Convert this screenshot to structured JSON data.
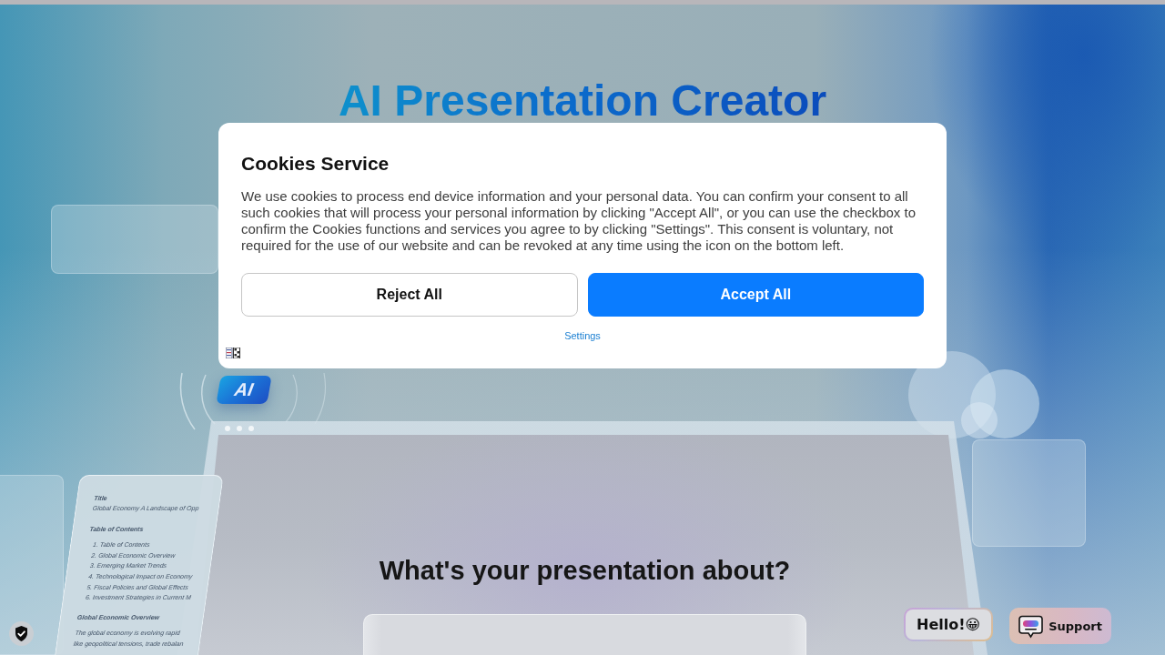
{
  "header": {
    "title": "AI Presentation Creator"
  },
  "hero": {
    "badge": "AI",
    "document": {
      "label": "Title",
      "title": "Global Economy A Landscape of Opp",
      "toc_heading": "Table of Contents",
      "toc": [
        "1. Table of Contents",
        "2. Global Economic Overview",
        "3. Emerging Market Trends",
        "4. Technological Impact on Economy",
        "5. Fiscal Policies and Global Effects",
        "6. Investment Strategies in Current M"
      ],
      "section_heading": "Global Economic Overview",
      "section_lines": [
        "The global economy is evolving rapid",
        "like geopolitical tensions, trade rebalan"
      ]
    }
  },
  "prompt": {
    "heading": "What's your presentation about?"
  },
  "cookie_dialog": {
    "title": "Cookies Service",
    "body": "We use cookies to process end device information and your personal data. You can confirm your consent to all such cookies that will process your personal information by clicking \"Accept All\", or you can use the checkbox to confirm the Cookies functions and services you agree to by clicking \"Settings\". This consent is voluntary, not required for the use of our website and can be revoked at any time using the icon on the bottom left.",
    "buttons": [
      {
        "label": "Reject All",
        "kind": "secondary"
      },
      {
        "label": "Accept All",
        "kind": "primary"
      }
    ],
    "settings_link": "Settings"
  },
  "floating_buttons": [
    {
      "kind": "greeting",
      "label": "Hello!😀"
    },
    {
      "kind": "support",
      "label": "Support"
    }
  ]
}
